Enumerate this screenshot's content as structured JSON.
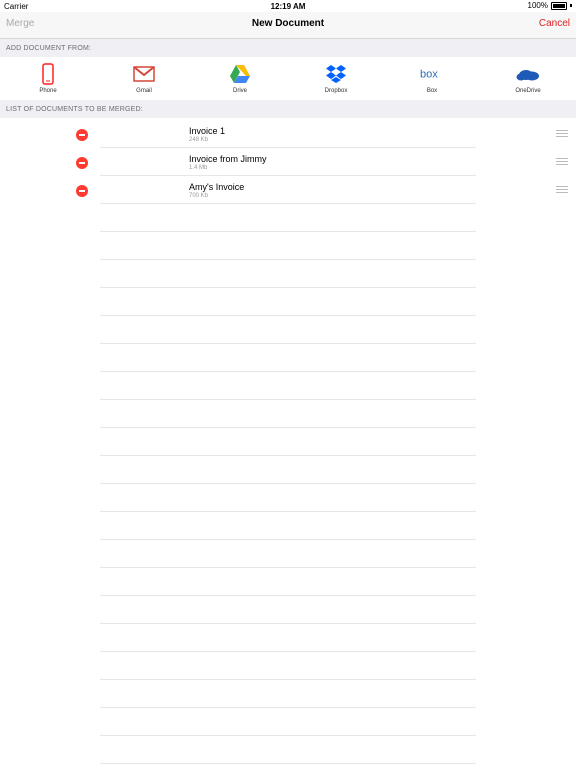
{
  "status_bar": {
    "carrier": "Carrier",
    "time": "12:19 AM",
    "battery": "100%"
  },
  "nav": {
    "left": "Merge",
    "title": "New Document",
    "right": "Cancel"
  },
  "add_section": {
    "header": "ADD DOCUMENT FROM:"
  },
  "sources": [
    {
      "label": "Phone",
      "icon": "phone-icon"
    },
    {
      "label": "Gmail",
      "icon": "gmail-icon"
    },
    {
      "label": "Drive",
      "icon": "google-drive-icon"
    },
    {
      "label": "Dropbox",
      "icon": "dropbox-icon"
    },
    {
      "label": "Box",
      "icon": "box-icon"
    },
    {
      "label": "OneDrive",
      "icon": "onedrive-icon"
    }
  ],
  "merge_section": {
    "header": "LIST OF DOCUMENTS TO BE MERGED:"
  },
  "documents": [
    {
      "name": "Invoice 1",
      "size": "248 Kb"
    },
    {
      "name": "Invoice from Jimmy",
      "size": "1.4 Mb"
    },
    {
      "name": "Amy's Invoice",
      "size": "700 Kb"
    }
  ],
  "colors": {
    "accent": "#e02020",
    "delete": "#ff3b30",
    "section_bg": "#efeff4",
    "navbar_bg": "#f7f7f7"
  }
}
